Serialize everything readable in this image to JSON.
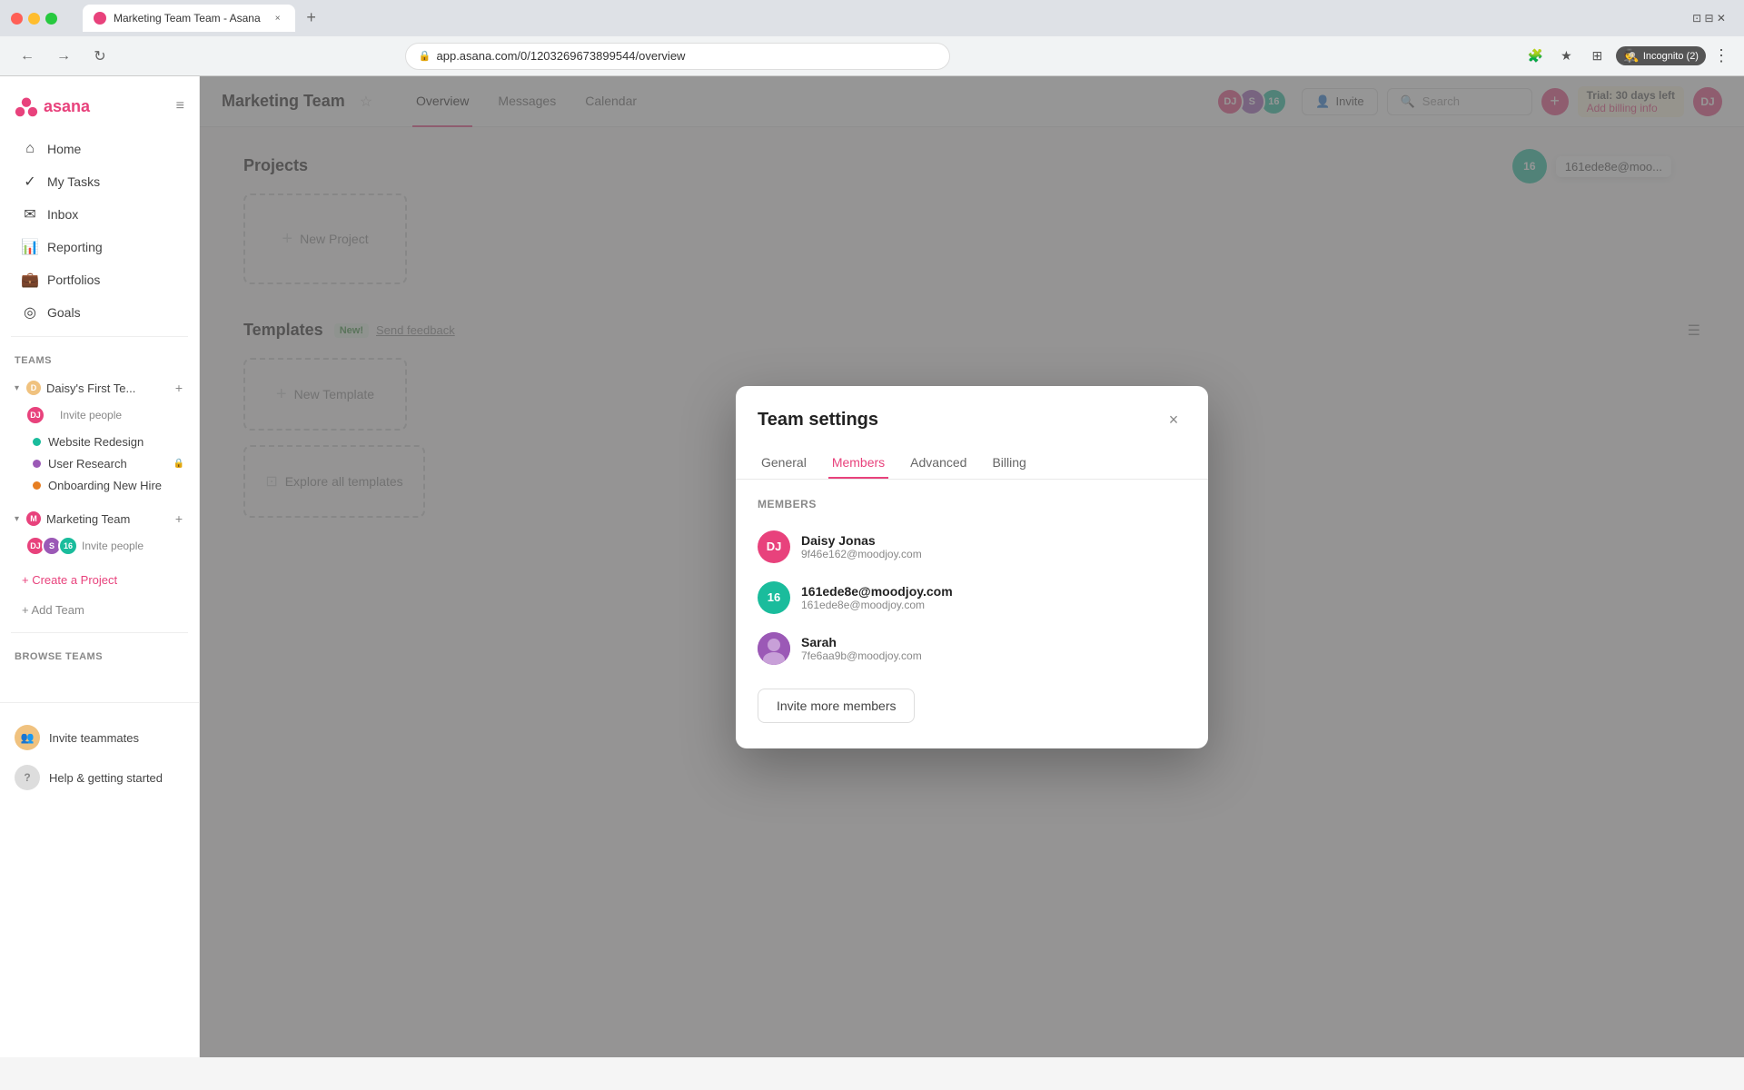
{
  "browser": {
    "tab_title": "Marketing Team Team - Asana",
    "tab_favicon": "asana",
    "address": "app.asana.com/0/1203269673899544/overview",
    "incognito_label": "Incognito (2)",
    "new_tab_icon": "+"
  },
  "sidebar": {
    "logo_text": "asana",
    "hamburger_icon": "≡",
    "nav_items": [
      {
        "id": "home",
        "label": "Home",
        "icon": "⌂"
      },
      {
        "id": "my-tasks",
        "label": "My Tasks",
        "icon": "✓"
      },
      {
        "id": "inbox",
        "label": "Inbox",
        "icon": "✉"
      },
      {
        "id": "reporting",
        "label": "Reporting",
        "icon": "📊"
      },
      {
        "id": "portfolios",
        "label": "Portfolios",
        "icon": "💼"
      },
      {
        "id": "goals",
        "label": "Goals",
        "icon": "◎"
      }
    ],
    "teams_label": "Teams",
    "team1": {
      "name": "Daisy's First Te...",
      "expand_icon": "▾",
      "add_icon": "+",
      "avatars": [
        {
          "initials": "DJ",
          "color": "#e8427c"
        }
      ],
      "invite_label": "Invite people"
    },
    "team1_projects": [
      {
        "name": "Website Redesign",
        "dot_color": "#1abc9c"
      },
      {
        "name": "User Research",
        "dot_color": "#9b59b6",
        "lock_icon": "🔒"
      },
      {
        "name": "Onboarding New Hire",
        "dot_color": "#e67e22"
      }
    ],
    "team2": {
      "name": "Marketing Team",
      "expand_icon": "▾",
      "add_icon": "+",
      "avatars": [
        {
          "initials": "DJ",
          "color": "#e8427c"
        },
        {
          "initials": "S",
          "color": "#9b59b6"
        },
        {
          "initials": "16",
          "color": "#1abc9c"
        }
      ],
      "invite_label": "Invite people"
    },
    "create_project_label": "+ Create a Project",
    "add_team_label": "+ Add Team",
    "browse_teams_label": "Browse teams",
    "footer": {
      "invite_label": "Invite teammates",
      "help_label": "Help & getting started"
    }
  },
  "main": {
    "team_name": "Marketing Team",
    "star_icon": "☆",
    "tabs": [
      {
        "id": "overview",
        "label": "Overview",
        "active": true
      },
      {
        "id": "messages",
        "label": "Messages"
      },
      {
        "id": "calendar",
        "label": "Calendar"
      }
    ],
    "header_avatars": [
      {
        "initials": "DJ",
        "color": "#e8427c"
      },
      {
        "initials": "S",
        "color": "#9b59b6"
      },
      {
        "initials": "16",
        "color": "#1abc9c"
      }
    ],
    "invite_btn_label": "Invite",
    "invite_icon": "👤",
    "search_placeholder": "Search",
    "trial_banner": {
      "text": "Trial: 30 days left",
      "link": "Add billing info"
    },
    "user_avatar": {
      "initials": "DJ",
      "color": "#e8427c"
    },
    "projects_title": "Projects",
    "new_project_label": "New Project",
    "templates_title": "Templates",
    "new_badge": "New!",
    "send_feedback_label": "Send feedback",
    "new_template_label": "New Template",
    "explore_templates_label": "Explore all templates",
    "floating_avatar": {
      "initials": "16",
      "color": "#1abc9c",
      "label": "161ede8e@moo..."
    }
  },
  "modal": {
    "title": "Team settings",
    "close_icon": "×",
    "tabs": [
      {
        "id": "general",
        "label": "General"
      },
      {
        "id": "members",
        "label": "Members",
        "active": true
      },
      {
        "id": "advanced",
        "label": "Advanced"
      },
      {
        "id": "billing",
        "label": "Billing"
      }
    ],
    "members_section_label": "Members",
    "members": [
      {
        "id": "daisy",
        "name": "Daisy Jonas",
        "email": "9f46e162@moodjoy.com",
        "initials": "DJ",
        "avatar_color": "#e8427c"
      },
      {
        "id": "user2",
        "name": "161ede8e@moodjoy.com",
        "email": "161ede8e@moodjoy.com",
        "initials": "16",
        "avatar_color": "#1abc9c"
      },
      {
        "id": "sarah",
        "name": "Sarah",
        "email": "7fe6aa9b@moodjoy.com",
        "initials": "S",
        "avatar_color": "#9b59b6",
        "has_photo": true
      }
    ],
    "invite_more_btn_label": "Invite more members"
  }
}
